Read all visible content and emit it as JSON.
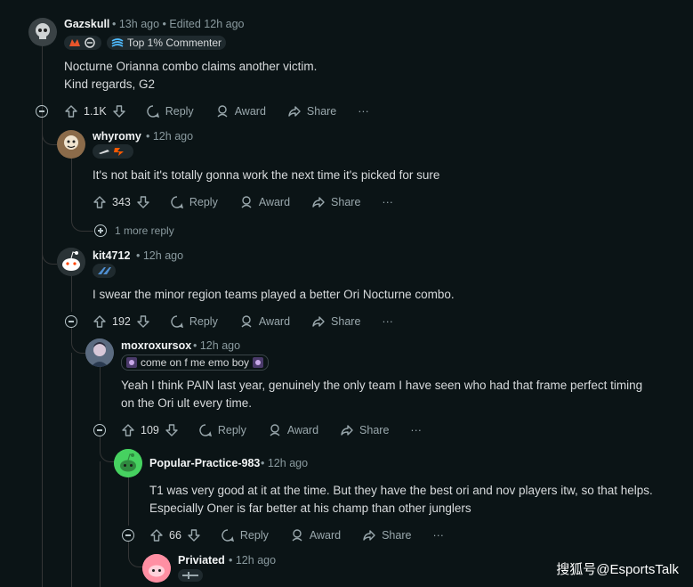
{
  "comments": [
    {
      "username": "Gazskull",
      "time": "13h ago",
      "edited": "Edited 12h ago",
      "badge": "Top 1% Commenter",
      "body": [
        "Nocturne Orianna combo claims another victim.",
        "Kind regards, G2"
      ],
      "votes": "1.1K"
    },
    {
      "username": "whyromy",
      "time": "12h ago",
      "body": [
        "It's not bait it's totally gonna work the next time it's picked for sure"
      ],
      "votes": "343",
      "more_replies": "1 more reply"
    },
    {
      "username": "kit4712",
      "time": "12h ago",
      "body": [
        "I swear the minor region teams played a better Ori Nocturne combo."
      ],
      "votes": "192"
    },
    {
      "username": "moxroxursox",
      "time": "12h ago",
      "flair": "come on f me emo boy",
      "body": [
        "Yeah I think PAIN last year, genuinely the only team I have seen who had that frame perfect timing",
        "on the Ori ult every time."
      ],
      "votes": "109"
    },
    {
      "username": "Popular-Practice-983",
      "time": "12h ago",
      "body": [
        "T1 was very good at it at the time. But they have the best ori and nov players itw, so that helps.",
        "Especially Oner is far better at his champ than other junglers"
      ],
      "votes": "66"
    },
    {
      "username": "Priviated",
      "time": "12h ago"
    }
  ],
  "actions": {
    "reply": "Reply",
    "award": "Award",
    "share": "Share",
    "more": "···"
  },
  "watermark": "搜狐号@EsportsTalk",
  "colors": {
    "background": "#0b1416",
    "text": "#d7dadc",
    "muted": "#8a9a9f",
    "thread_line": "#343536",
    "avatar_green": "#46d160",
    "avatar_pink": "#ff8fa3"
  }
}
